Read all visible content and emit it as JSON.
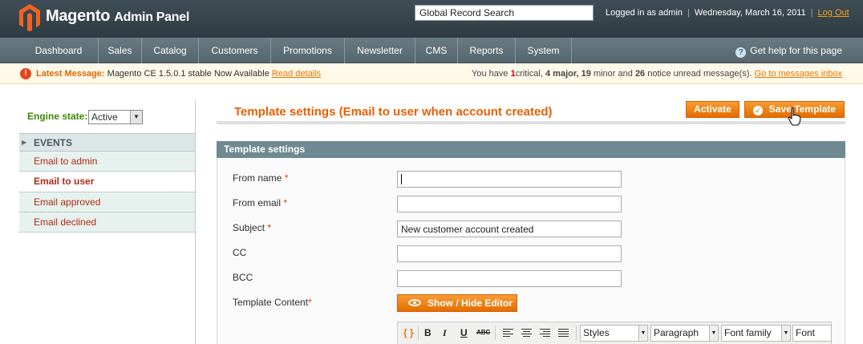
{
  "header": {
    "brand": "Magento",
    "brand_sub": "Admin Panel",
    "search_value": "Global Record Search",
    "logged_in": "Logged in as admin",
    "date": "Wednesday, March 16, 2011",
    "logout": "Log Out"
  },
  "nav": {
    "items": [
      "Dashboard",
      "Sales",
      "Catalog",
      "Customers",
      "Promotions",
      "Newsletter",
      "CMS",
      "Reports",
      "System"
    ],
    "help": "Get help for this page"
  },
  "messages": {
    "latest_label": "Latest Message:",
    "latest_text": "Magento CE 1.5.0.1 stable Now Available",
    "read_details": "Read details",
    "you_have": "You have",
    "critical_count": "1",
    "critical_label": "critical",
    "major": "4 major,",
    "minor_count": "19",
    "minor_label": "minor and",
    "notice_count": "26",
    "notice_label": "notice unread message(s).",
    "go_inbox": "Go to messages inbox"
  },
  "sidebar": {
    "engine_label": "Engine state:",
    "engine_value": "Active",
    "events_header": "EVENTS",
    "items": [
      "Email to admin",
      "Email to user",
      "Email approved",
      "Email declined"
    ]
  },
  "main": {
    "title": "Template settings (Email to user when account created)",
    "activate": "Activate",
    "save_template": "Save Template",
    "panel_title": "Template settings",
    "fields": {
      "from_name": "From name",
      "from_email": "From email",
      "subject": "Subject",
      "subject_value": "New customer account created",
      "cc": "CC",
      "bcc": "BCC",
      "template_content": "Template Content"
    },
    "required_mark": "*",
    "show_hide": "Show / Hide Editor",
    "toolbar": {
      "styles": "Styles",
      "paragraph": "Paragraph",
      "font_family": "Font family",
      "font_size": "Font size",
      "bold": "B",
      "italic": "I",
      "underline": "U",
      "strike": "ABC"
    }
  },
  "colors": {
    "accent": "#eb5e00",
    "header_bg": "#3f4e56",
    "nav_bg": "#5f6f77",
    "panel_header": "#6f8992"
  }
}
